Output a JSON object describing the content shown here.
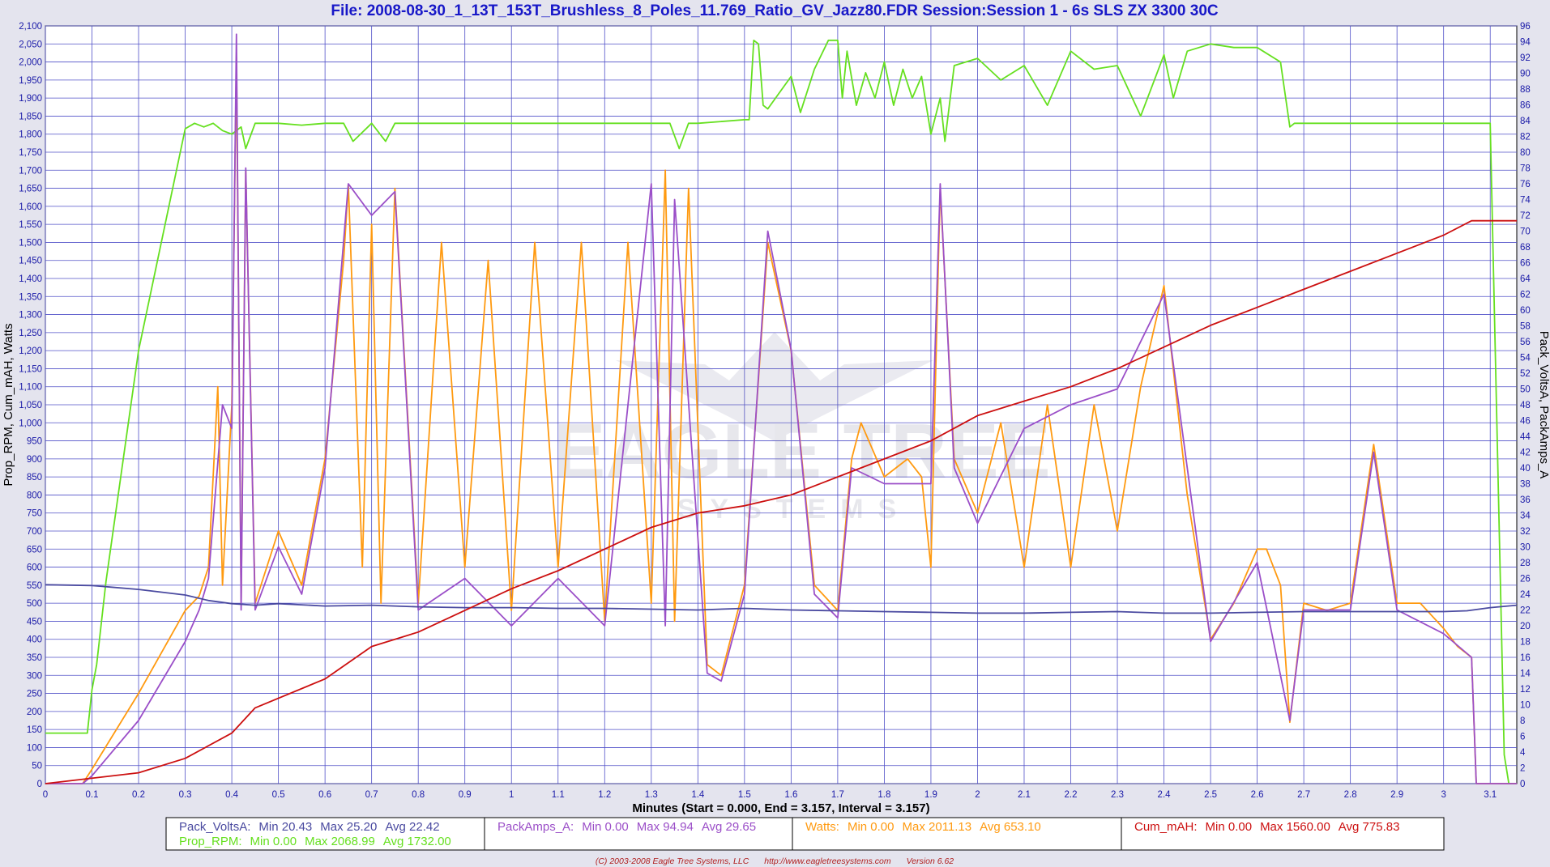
{
  "colors": {
    "background": "#e4e4ee",
    "plot_background": "#ffffff",
    "grid": "#5050c8",
    "title": "#1818c8",
    "pack_volts": "#4a4aa0",
    "pack_amps": "#9b4fc8",
    "prop_rpm": "#66e020",
    "watts": "#ff9a10",
    "cum_mah": "#cc1010",
    "copyright": "#b02020"
  },
  "chart_data": {
    "type": "line",
    "title": "File: 2008-08-30_1_13T_153T_Brushless_8_Poles_11.769_Ratio_GV_Jazz80.FDR   Session:Session 1 - 6s SLS ZX 3300 30C",
    "xlabel": "Minutes (Start = 0.000,  End = 3.157,  Interval =  3.157)",
    "ylabel_left": "Prop_RPM, Cum_mAH, Watts",
    "ylabel_right": "Pack_VoltsA, PackAmps_A",
    "xlim": [
      0,
      3.157
    ],
    "ylim_left": [
      0,
      2100
    ],
    "ylim_right": [
      0,
      96
    ],
    "grid": true,
    "legend_placement": "bottom",
    "x_ticks": [
      "0",
      "0.1",
      "0.2",
      "0.3",
      "0.4",
      "0.5",
      "0.6",
      "0.7",
      "0.8",
      "0.9",
      "1",
      "1.1",
      "1.2",
      "1.3",
      "1.4",
      "1.5",
      "1.6",
      "1.7",
      "1.8",
      "1.9",
      "2",
      "2.1",
      "2.2",
      "2.3",
      "2.4",
      "2.5",
      "2.6",
      "2.7",
      "2.8",
      "2.9",
      "3",
      "3.1"
    ],
    "y_left_ticks": [
      "0",
      "50",
      "100",
      "150",
      "200",
      "250",
      "300",
      "350",
      "400",
      "450",
      "500",
      "550",
      "600",
      "650",
      "700",
      "750",
      "800",
      "850",
      "900",
      "950",
      "1,000",
      "1,050",
      "1,100",
      "1,150",
      "1,200",
      "1,250",
      "1,300",
      "1,350",
      "1,400",
      "1,450",
      "1,500",
      "1,550",
      "1,600",
      "1,650",
      "1,700",
      "1,750",
      "1,800",
      "1,850",
      "1,900",
      "1,950",
      "2,000",
      "2,050",
      "2,100"
    ],
    "y_right_ticks": [
      "0",
      "2",
      "4",
      "6",
      "8",
      "10",
      "12",
      "14",
      "16",
      "18",
      "20",
      "22",
      "24",
      "26",
      "28",
      "30",
      "32",
      "34",
      "36",
      "38",
      "40",
      "42",
      "44",
      "46",
      "48",
      "50",
      "52",
      "54",
      "56",
      "58",
      "60",
      "62",
      "64",
      "66",
      "68",
      "70",
      "72",
      "74",
      "76",
      "78",
      "80",
      "82",
      "84",
      "86",
      "88",
      "90",
      "92",
      "94",
      "96"
    ],
    "series": [
      {
        "name": "Prop_RPM",
        "axis": "left",
        "color_key": "prop_rpm",
        "x": [
          0,
          0.09,
          0.09,
          0.1,
          0.11,
          0.13,
          0.2,
          0.3,
          0.32,
          0.34,
          0.36,
          0.38,
          0.4,
          0.42,
          0.43,
          0.45,
          0.5,
          0.55,
          0.6,
          0.64,
          0.66,
          0.7,
          0.73,
          0.75,
          0.8,
          0.9,
          1.0,
          1.1,
          1.2,
          1.3,
          1.34,
          1.36,
          1.38,
          1.4,
          1.5,
          1.51,
          1.52,
          1.53,
          1.54,
          1.55,
          1.6,
          1.62,
          1.65,
          1.68,
          1.7,
          1.71,
          1.72,
          1.74,
          1.76,
          1.78,
          1.8,
          1.82,
          1.84,
          1.86,
          1.88,
          1.9,
          1.92,
          1.93,
          1.95,
          2.0,
          2.05,
          2.1,
          2.15,
          2.2,
          2.25,
          2.3,
          2.35,
          2.4,
          2.42,
          2.45,
          2.5,
          2.55,
          2.6,
          2.65,
          2.67,
          2.68,
          2.7,
          2.8,
          2.9,
          3.0,
          3.04,
          3.06,
          3.1,
          3.13,
          3.14,
          3.157
        ],
        "y": [
          140,
          140,
          140,
          260,
          330,
          560,
          1200,
          1815,
          1830,
          1820,
          1830,
          1810,
          1800,
          1820,
          1760,
          1830,
          1830,
          1825,
          1830,
          1830,
          1780,
          1830,
          1780,
          1830,
          1830,
          1830,
          1830,
          1830,
          1830,
          1830,
          1830,
          1760,
          1830,
          1830,
          1840,
          1840,
          2060,
          2050,
          1880,
          1870,
          1960,
          1860,
          1980,
          2060,
          2060,
          1900,
          2030,
          1880,
          1970,
          1900,
          2000,
          1880,
          1980,
          1900,
          1960,
          1800,
          1900,
          1780,
          1990,
          2010,
          1950,
          1990,
          1880,
          2030,
          1980,
          1990,
          1850,
          2020,
          1900,
          2030,
          2050,
          2040,
          2040,
          2000,
          1820,
          1830,
          1830,
          1830,
          1830,
          1830,
          1830,
          1830,
          1830,
          80,
          0,
          0
        ]
      },
      {
        "name": "Watts",
        "axis": "left",
        "color_key": "watts",
        "x": [
          0,
          0.08,
          0.1,
          0.2,
          0.3,
          0.33,
          0.35,
          0.37,
          0.38,
          0.4,
          0.41,
          0.42,
          0.43,
          0.45,
          0.5,
          0.55,
          0.6,
          0.64,
          0.65,
          0.68,
          0.7,
          0.72,
          0.75,
          0.8,
          0.85,
          0.9,
          0.95,
          1.0,
          1.05,
          1.1,
          1.15,
          1.2,
          1.25,
          1.3,
          1.33,
          1.35,
          1.38,
          1.42,
          1.45,
          1.5,
          1.55,
          1.6,
          1.65,
          1.7,
          1.73,
          1.75,
          1.8,
          1.85,
          1.88,
          1.9,
          1.92,
          1.95,
          2.0,
          2.05,
          2.1,
          2.15,
          2.2,
          2.25,
          2.3,
          2.35,
          2.4,
          2.45,
          2.5,
          2.55,
          2.6,
          2.62,
          2.65,
          2.67,
          2.7,
          2.75,
          2.8,
          2.85,
          2.9,
          2.95,
          3.0,
          3.03,
          3.06,
          3.07,
          3.1,
          3.157
        ],
        "y": [
          0,
          0,
          40,
          250,
          480,
          520,
          600,
          1100,
          550,
          1050,
          2011,
          500,
          1700,
          500,
          700,
          550,
          900,
          1450,
          1660,
          600,
          1550,
          500,
          1650,
          500,
          1500,
          600,
          1450,
          480,
          1500,
          600,
          1500,
          450,
          1500,
          500,
          1700,
          450,
          1650,
          330,
          300,
          550,
          1500,
          1200,
          550,
          480,
          900,
          1000,
          850,
          900,
          850,
          600,
          1650,
          900,
          750,
          1000,
          600,
          1050,
          600,
          1050,
          700,
          1100,
          1380,
          800,
          400,
          500,
          650,
          650,
          550,
          170,
          500,
          480,
          500,
          940,
          500,
          500,
          430,
          380,
          350,
          0,
          0,
          0
        ]
      },
      {
        "name": "PackAmps_A",
        "axis": "right",
        "color_key": "pack_amps",
        "x": [
          0,
          0.08,
          0.1,
          0.2,
          0.3,
          0.33,
          0.35,
          0.38,
          0.4,
          0.41,
          0.42,
          0.43,
          0.45,
          0.5,
          0.55,
          0.6,
          0.65,
          0.7,
          0.75,
          0.8,
          0.9,
          1.0,
          1.1,
          1.2,
          1.3,
          1.33,
          1.35,
          1.42,
          1.45,
          1.5,
          1.55,
          1.6,
          1.65,
          1.7,
          1.73,
          1.8,
          1.9,
          1.92,
          1.95,
          2.0,
          2.1,
          2.2,
          2.3,
          2.4,
          2.45,
          2.5,
          2.6,
          2.67,
          2.7,
          2.8,
          2.85,
          2.9,
          3.0,
          3.06,
          3.07,
          3.157
        ],
        "y": [
          0,
          0,
          1,
          8,
          18,
          22,
          26,
          48,
          45,
          94.94,
          22,
          78,
          22,
          30,
          24,
          40,
          76,
          72,
          75,
          22,
          26,
          20,
          26,
          20,
          76,
          20,
          74,
          14,
          13,
          24,
          70,
          55,
          24,
          21,
          40,
          38,
          38,
          76,
          40,
          33,
          45,
          48,
          50,
          62,
          40,
          18,
          28,
          8,
          22,
          22,
          42,
          22,
          19,
          16,
          0,
          0
        ]
      },
      {
        "name": "Pack_VoltsA",
        "axis": "right",
        "color_key": "pack_volts",
        "x": [
          0,
          0.1,
          0.2,
          0.3,
          0.35,
          0.4,
          0.45,
          0.5,
          0.6,
          0.7,
          0.8,
          0.9,
          1.0,
          1.1,
          1.2,
          1.3,
          1.4,
          1.5,
          1.6,
          1.7,
          1.8,
          1.9,
          2.0,
          2.1,
          2.2,
          2.3,
          2.4,
          2.5,
          2.6,
          2.7,
          2.8,
          2.9,
          3.0,
          3.05,
          3.1,
          3.157
        ],
        "y": [
          25.2,
          25.1,
          24.6,
          23.9,
          23.2,
          22.8,
          22.6,
          22.8,
          22.5,
          22.6,
          22.4,
          22.3,
          22.3,
          22.2,
          22.2,
          22.1,
          22.0,
          22.2,
          22.0,
          21.9,
          21.8,
          21.7,
          21.6,
          21.6,
          21.7,
          21.8,
          21.6,
          21.6,
          21.7,
          21.8,
          21.8,
          21.8,
          21.8,
          21.9,
          22.3,
          22.6
        ]
      },
      {
        "name": "Cum_mAH",
        "axis": "left",
        "color_key": "cum_mah",
        "x": [
          0,
          0.2,
          0.3,
          0.4,
          0.45,
          0.6,
          0.7,
          0.8,
          0.9,
          1.0,
          1.1,
          1.2,
          1.3,
          1.4,
          1.5,
          1.6,
          1.7,
          1.8,
          1.9,
          2.0,
          2.1,
          2.2,
          2.3,
          2.4,
          2.5,
          2.6,
          2.7,
          2.8,
          2.9,
          3.0,
          3.06,
          3.157
        ],
        "y": [
          0,
          30,
          70,
          140,
          210,
          290,
          380,
          420,
          480,
          540,
          590,
          650,
          710,
          750,
          770,
          800,
          850,
          900,
          950,
          1020,
          1060,
          1100,
          1150,
          1210,
          1270,
          1320,
          1370,
          1420,
          1470,
          1520,
          1560,
          1560
        ]
      }
    ],
    "legend": [
      [
        {
          "series": "Pack_VoltsA",
          "name": "Pack_VoltsA:",
          "min": "Min 20.43",
          "max": "Max 25.20",
          "avg": "Avg 22.42",
          "color_key": "pack_volts"
        },
        {
          "series": "Prop_RPM",
          "name": "Prop_RPM:",
          "min": "Min 0.00",
          "max": "Max 2068.99",
          "avg": "Avg 1732.00",
          "color_key": "prop_rpm"
        }
      ],
      [
        {
          "series": "PackAmps_A",
          "name": "PackAmps_A:",
          "min": "Min 0.00",
          "max": "Max 94.94",
          "avg": "Avg 29.65",
          "color_key": "pack_amps"
        }
      ],
      [
        {
          "series": "Watts",
          "name": "Watts:",
          "min": "Min 0.00",
          "max": "Max 2011.13",
          "avg": "Avg 653.10",
          "color_key": "watts"
        }
      ],
      [
        {
          "series": "Cum_mAH",
          "name": "Cum_mAH:",
          "min": "Min 0.00",
          "max": "Max 1560.00",
          "avg": "Avg 775.83",
          "color_key": "cum_mah"
        }
      ]
    ]
  },
  "watermark": {
    "top": "EAGLE TREE",
    "bottom": "SYSTEMS"
  },
  "footer": {
    "copyright": "(C) 2003-2008 Eagle Tree Systems, LLC",
    "url": "http://www.eagletreesystems.com",
    "version": "Version 6.62"
  }
}
